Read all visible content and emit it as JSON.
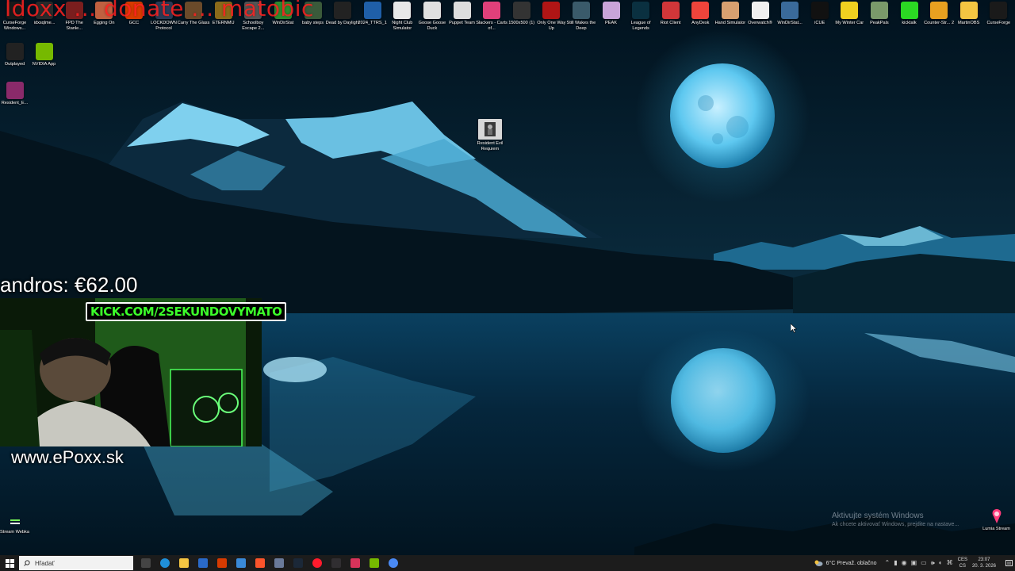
{
  "overlay": {
    "banner_text": "Idoxx ... donate ... matobic",
    "donation_text": "andros: €62.00",
    "kick_text": "KICK.COM/2SEKUNDOVYMATO",
    "website_text": "www.ePoxx.sk"
  },
  "desktop_icons_top": [
    {
      "label": "CurseForge Windows...",
      "icon": "curseforge-icon",
      "color": "#1a1a1a"
    },
    {
      "label": "idxsqlme...",
      "icon": "file-icon",
      "color": "#2a2a2a"
    },
    {
      "label": "FPD The Stanle...",
      "icon": "game-icon",
      "color": "#7a1e1e"
    },
    {
      "label": "Egging On",
      "icon": "game-icon",
      "color": "#c06040"
    },
    {
      "label": "GCC",
      "icon": "game-icon",
      "color": "#d83b01"
    },
    {
      "label": "LOCKDOWN Protocol",
      "icon": "game-icon",
      "color": "#2b3a55"
    },
    {
      "label": "Carry The Glass",
      "icon": "game-icon",
      "color": "#6a4a2a"
    },
    {
      "label": "ETERNMU",
      "icon": "game-icon",
      "color": "#8a6a1a"
    },
    {
      "label": "Schoolboy Escape 2...",
      "icon": "game-icon",
      "color": "#555"
    },
    {
      "label": "WinDirStat",
      "icon": "chart-icon",
      "color": "#2e8b2e"
    },
    {
      "label": "baby steps",
      "icon": "game-icon",
      "color": "#3a5a3a"
    },
    {
      "label": "Dead by Daylight",
      "icon": "game-icon",
      "color": "#222"
    },
    {
      "label": "2024_TTRS_1",
      "icon": "file-icon",
      "color": "#1f5fa8"
    },
    {
      "label": "Night Club Simulator",
      "icon": "game-icon",
      "color": "#e8e8e8"
    },
    {
      "label": "Goose Goose Duck",
      "icon": "game-icon",
      "color": "#e0e0e0"
    },
    {
      "label": "Puppet Team",
      "icon": "game-icon",
      "color": "#ddd"
    },
    {
      "label": "Slackers - Carts of...",
      "icon": "game-icon",
      "color": "#e0407a"
    },
    {
      "label": "1500x500 (1)",
      "icon": "image-icon",
      "color": "#333"
    },
    {
      "label": "Only One Way Up",
      "icon": "game-icon",
      "color": "#b01515"
    },
    {
      "label": "Still Wakes the Deep",
      "icon": "game-icon",
      "color": "#3a5a6a"
    },
    {
      "label": "PEAK",
      "icon": "game-icon",
      "color": "#c9a4d8"
    },
    {
      "label": "League of Legends",
      "icon": "game-icon",
      "color": "#0a3040"
    },
    {
      "label": "Riot Client",
      "icon": "riot-icon",
      "color": "#d13639"
    },
    {
      "label": "AnyDesk",
      "icon": "anydesk-icon",
      "color": "#ef443b"
    },
    {
      "label": "Hand Simulator",
      "icon": "game-icon",
      "color": "#d8a070"
    },
    {
      "label": "Overwatch®",
      "icon": "overwatch-icon",
      "color": "#f0f0f0"
    },
    {
      "label": "WinDirStat...",
      "icon": "chart-icon",
      "color": "#3a6a9a"
    },
    {
      "label": "iCUE",
      "icon": "icue-icon",
      "color": "#111"
    },
    {
      "label": "My Winter Car",
      "icon": "game-icon",
      "color": "#f0d020"
    },
    {
      "label": "PeakPals",
      "icon": "game-icon",
      "color": "#7a9a6a"
    },
    {
      "label": "kicktalk",
      "icon": "kick-icon",
      "color": "#2bd923"
    },
    {
      "label": "Counter-Str... 2",
      "icon": "cs2-icon",
      "color": "#e8a020"
    },
    {
      "label": "MartinOBS",
      "icon": "folder-icon",
      "color": "#f4c542"
    },
    {
      "label": "CurseForge",
      "icon": "curseforge-icon",
      "color": "#1a1a1a"
    }
  ],
  "desktop_icons_left": [
    {
      "label": "Outplayed",
      "icon": "outplayed-icon",
      "color": "#222"
    },
    {
      "label": "NVIDIA App",
      "icon": "nvidia-icon",
      "color": "#76b900"
    },
    {
      "label": "Resident_E...",
      "icon": "winrar-icon",
      "color": "#8a2a6a"
    }
  ],
  "desktop_icon_center": {
    "label": "Resident Evil Requiem",
    "icon": "resident-evil-icon"
  },
  "desktop_icon_bottom_left": {
    "label": "Stream Webka",
    "icon": "stream-icon"
  },
  "desktop_icon_bottom_right": {
    "label": "Lumia Stream",
    "icon": "lumia-icon"
  },
  "watermark": {
    "line1": "Aktivujte systém Windows",
    "line2": "Ak chcete aktivovať Windows, prejdite na nastave..."
  },
  "taskbar": {
    "search_placeholder": "Hľadať",
    "apps": [
      {
        "icon": "task-view-icon",
        "color": "#444"
      },
      {
        "icon": "edge-icon",
        "color": "#1f8fd8"
      },
      {
        "icon": "file-explorer-icon",
        "color": "#f4c542"
      },
      {
        "icon": "notepad-icon",
        "color": "#2a6ac8"
      },
      {
        "icon": "app-icon",
        "color": "#d83b01"
      },
      {
        "icon": "store-icon",
        "color": "#3a8ad8"
      },
      {
        "icon": "brave-icon",
        "color": "#fb542b"
      },
      {
        "icon": "app-icon",
        "color": "#6a7a9a"
      },
      {
        "icon": "steam-icon",
        "color": "#1b2838"
      },
      {
        "icon": "opera-icon",
        "color": "#ff1b2d"
      },
      {
        "icon": "obs-icon",
        "color": "#302e31"
      },
      {
        "icon": "maps-icon",
        "color": "#d8335a"
      },
      {
        "icon": "nvidia-icon",
        "color": "#76b900"
      },
      {
        "icon": "chrome-icon",
        "color": "#4a8af4"
      }
    ],
    "weather_text": "6°C  Prevaž. oblačno",
    "lang": "CES\nCS",
    "time": "23:07",
    "date": "20. 3. 2026"
  }
}
